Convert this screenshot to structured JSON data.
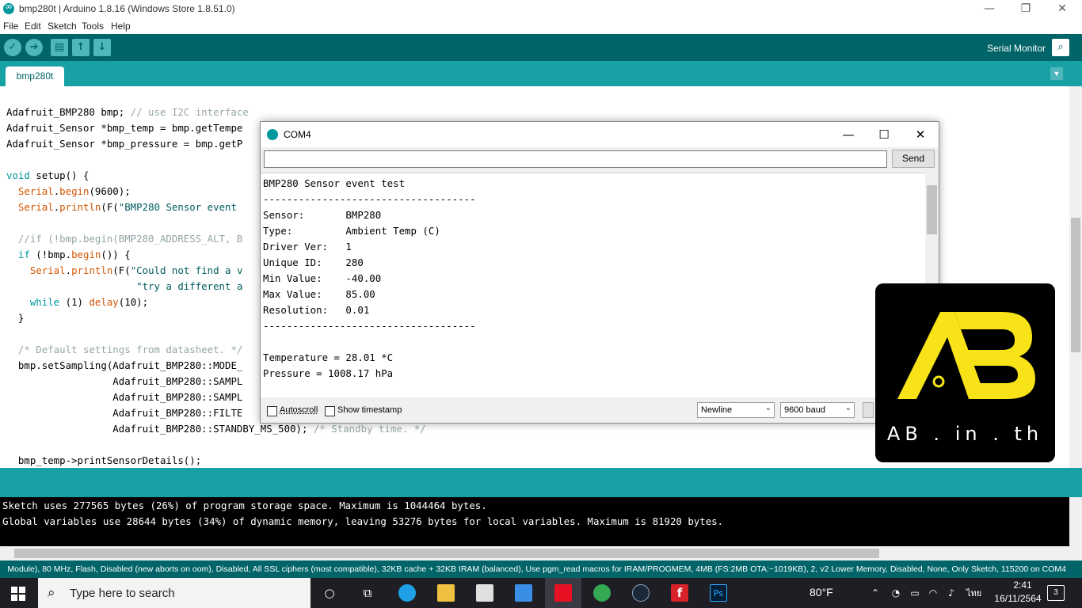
{
  "window": {
    "title": "bmp280t | Arduino 1.8.16 (Windows Store 1.8.51.0)",
    "minimize_glyph": "—",
    "restore_glyph": "❐",
    "close_glyph": "✕"
  },
  "menu": [
    "File",
    "Edit",
    "Sketch",
    "Tools",
    "Help"
  ],
  "toolbar": {
    "verify_icon": "✓",
    "upload_icon": "➔",
    "new_icon": "▤",
    "open_icon": "↑",
    "save_icon": "↓",
    "serial_monitor_label": "Serial Monitor",
    "serial_monitor_icon": "⌕"
  },
  "tabs": [
    {
      "label": "bmp280t"
    }
  ],
  "tab_menu_icon": "▼",
  "editor": {
    "lines": [
      "Adafruit_BMP280 bmp; // use I2C interface",
      "Adafruit_Sensor *bmp_temp = bmp.getTempe",
      "Adafruit_Sensor *bmp_pressure = bmp.getP",
      "",
      "void setup() {",
      "  Serial.begin(9600);",
      "  Serial.println(F(\"BMP280 Sensor event ",
      "",
      "  //if (!bmp.begin(BMP280_ADDRESS_ALT, B",
      "  if (!bmp.begin()) {",
      "    Serial.println(F(\"Could not find a v",
      "                      \"try a different a",
      "    while (1) delay(10);",
      "  }",
      "",
      "  /* Default settings from datasheet. */",
      "  bmp.setSampling(Adafruit_BMP280::MODE_",
      "                  Adafruit_BMP280::SAMPL",
      "                  Adafruit_BMP280::SAMPL",
      "                  Adafruit_BMP280::FILTE",
      "                  Adafruit_BMP280::STANDBY_MS_500); /* Standby time. */",
      "",
      "  bmp_temp->printSensorDetails();"
    ]
  },
  "console": {
    "lines": [
      "Sketch uses 277565 bytes (26%) of program storage space. Maximum is 1044464 bytes.",
      "Global variables use 28644 bytes (34%) of dynamic memory, leaving 53276 bytes for local variables. Maximum is 81920 bytes."
    ]
  },
  "status": {
    "text": "Module), 80 MHz, Flash, Disabled (new aborts on oom), Disabled, All SSL ciphers (most compatible), 32KB cache + 32KB IRAM (balanced), Use pgm_read macros for IRAM/PROGMEM, 4MB (FS:2MB OTA:~1019KB), 2, v2 Lower Memory, Disabled, None, Only Sketch, 115200 on COM4"
  },
  "serial_monitor": {
    "title": "COM4",
    "minimize_glyph": "—",
    "maximize_glyph": "☐",
    "close_glyph": "✕",
    "input_value": "",
    "send_label": "Send",
    "output": [
      "BMP280 Sensor event test",
      "------------------------------------",
      "Sensor:       BMP280",
      "Type:         Ambient Temp (C)",
      "Driver Ver:   1",
      "Unique ID:    280",
      "Min Value:    -40.00",
      "Max Value:    85.00",
      "Resolution:   0.01",
      "------------------------------------",
      "",
      "Temperature = 28.01 *C",
      "Pressure = 1008.17 hPa"
    ],
    "autoscroll_label": "Autoscroll",
    "autoscroll_checked": false,
    "timestamp_label": "Show timestamp",
    "timestamp_checked": false,
    "line_ending": "Newline",
    "baud": "9600 baud",
    "dropdown_arrow": "⌄"
  },
  "watermark": {
    "brand_text": "AB . in . th",
    "brand_color": "#f7e317"
  },
  "taskbar": {
    "search_placeholder": "Type here to search",
    "search_icon": "⌕",
    "weather": "80°F",
    "language": "ไทย",
    "time": "2:41",
    "date": "16/11/2564",
    "notification_count": "3"
  },
  "colors": {
    "arduino_dark": "#006468",
    "arduino_mid": "#17a1a5",
    "arduino_light": "#4db7bb"
  }
}
